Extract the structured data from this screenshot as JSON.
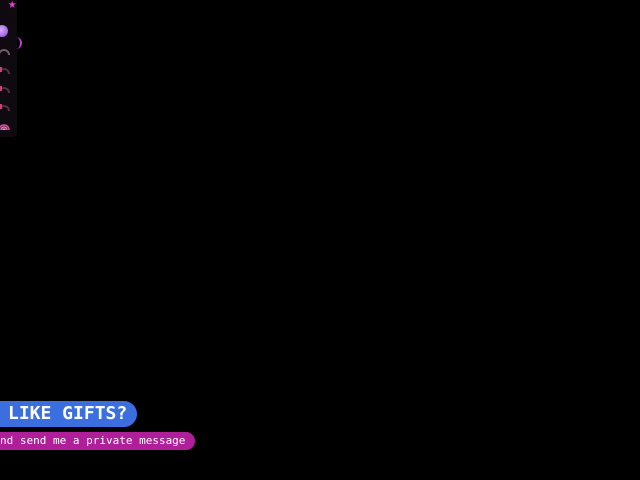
{
  "side_panel": {
    "star_icon": "star-icon",
    "avatar_icon": "avatar-icon",
    "items": [
      {
        "icon": "gauge-icon",
        "color": "#7a5a6a"
      },
      {
        "icon": "tip-icon",
        "color": "#d04070"
      },
      {
        "icon": "tip-icon",
        "color": "#d04070"
      },
      {
        "icon": "tip-icon",
        "color": "#d04070"
      },
      {
        "icon": "rainbow-icon",
        "color": "#e050a0"
      }
    ]
  },
  "banners": {
    "gifts_text": "LIKE GIFTS?",
    "message_text": "nd send me a private message",
    "gifts_color": "#3b6fe0",
    "message_color": "#b01f9a"
  }
}
